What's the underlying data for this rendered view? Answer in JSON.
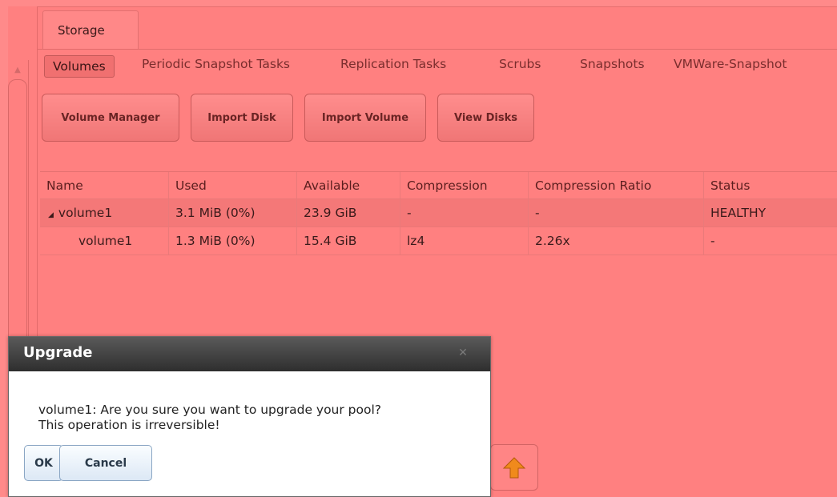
{
  "main_tab": "Storage",
  "subtabs": [
    "Volumes",
    "Periodic Snapshot Tasks",
    "Replication Tasks",
    "Scrubs",
    "Snapshots",
    "VMWare-Snapshot"
  ],
  "toolbar": {
    "volume_manager": "Volume Manager",
    "import_disk": "Import Disk",
    "import_volume": "Import Volume",
    "view_disks": "View Disks"
  },
  "table": {
    "columns": [
      "Name",
      "Used",
      "Available",
      "Compression",
      "Compression Ratio",
      "Status"
    ],
    "rows": [
      [
        "volume1",
        "3.1 MiB (0%)",
        "23.9 GiB",
        "-",
        "-",
        "HEALTHY"
      ],
      [
        "volume1",
        "1.3 MiB (0%)",
        "15.4 GiB",
        "lz4",
        "2.26x",
        "-"
      ]
    ]
  },
  "dialog": {
    "title": "Upgrade",
    "line1": "volume1: Are you sure you want to upgrade your pool?",
    "line2": "This operation is irreversible!",
    "ok": "OK",
    "cancel": "Cancel"
  },
  "colors": {
    "overlay": "#ff8080",
    "dialog_title_bg": "#3a3a3a",
    "upgrade_arrow": "#f08a1c"
  },
  "icons": {
    "tree_expanded": "triangle-down-icon",
    "dialog_close": "close-icon",
    "upgrade": "up-arrow-icon"
  }
}
